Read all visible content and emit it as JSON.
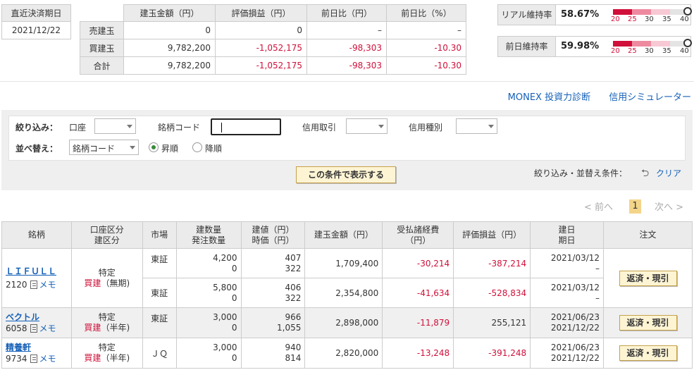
{
  "settlement": {
    "label": "直近決済期日",
    "date": "2021/12/22"
  },
  "summary": {
    "headers": [
      "建玉金額（円）",
      "評価損益（円）",
      "前日比（円）",
      "前日比（%）"
    ],
    "rows": [
      {
        "label": "売建玉",
        "amount": "0",
        "pl": "0",
        "diff_yen": "–",
        "diff_pct": "–"
      },
      {
        "label": "買建玉",
        "amount": "9,782,200",
        "pl": "-1,052,175",
        "diff_yen": "-98,303",
        "diff_pct": "-10.30"
      },
      {
        "label": "合計",
        "amount": "9,782,200",
        "pl": "-1,052,175",
        "diff_yen": "-98,303",
        "diff_pct": "-10.30"
      }
    ]
  },
  "ratios": [
    {
      "label": "リアル維持率",
      "value": "58.67%",
      "ticks": [
        "20",
        "25",
        "30",
        "35",
        "40"
      ]
    },
    {
      "label": "前日維持率",
      "value": "59.98%",
      "ticks": [
        "20",
        "25",
        "30",
        "35",
        "40"
      ]
    }
  ],
  "links": {
    "diagnosis": "MONEX 投資力診断",
    "simulator": "信用シミュレーター"
  },
  "filter": {
    "narrow_label": "絞り込み：",
    "account_label": "口座",
    "code_label": "銘柄コード",
    "credit_type_label": "信用取引",
    "credit_kind_label": "信用種別",
    "sort_label": "並べ替え：",
    "sort_value": "銘柄コード",
    "asc_label": "昇順",
    "desc_label": "降順",
    "show_button": "この条件で表示する",
    "condition_label": "絞り込み・並替え条件：",
    "clear_label": "クリア"
  },
  "pager": {
    "prev": "< 前へ",
    "current": "1",
    "next": "次へ >"
  },
  "table": {
    "headers": {
      "symbol": "銘柄",
      "account": [
        "口座区分",
        "建区分"
      ],
      "market": "市場",
      "qty": [
        "建数量",
        "発注数量"
      ],
      "price": [
        "建値（円）",
        "時価（円）"
      ],
      "amount": "建玉金額（円）",
      "fee": [
        "受払諸経費",
        "（円）"
      ],
      "pl": "評価損益（円）",
      "date": [
        "建日",
        "期日"
      ],
      "order": "注文"
    },
    "memo_label": "メモ",
    "action_label": "返済・現引",
    "groups": [
      {
        "name": "ＬＩＦＵＬＬ",
        "code": "2120",
        "account": "特定",
        "type": "買建",
        "term": "（無期)",
        "rows": [
          {
            "market": "東証",
            "qty": "4,200",
            "order_qty": "0",
            "price": "407",
            "market_price": "322",
            "amount": "1,709,400",
            "fee": "-30,214",
            "pl": "-387,214",
            "date": "2021/03/12",
            "due": "–"
          },
          {
            "market": "東証",
            "qty": "5,800",
            "order_qty": "0",
            "price": "406",
            "market_price": "322",
            "amount": "2,354,800",
            "fee": "-41,634",
            "pl": "-528,834",
            "date": "2021/03/12",
            "due": "–"
          }
        ]
      },
      {
        "name": "ベクトル",
        "code": "6058",
        "account": "特定",
        "type": "買建",
        "term": "（半年)",
        "rows": [
          {
            "market": "東証",
            "qty": "3,000",
            "order_qty": "0",
            "price": "966",
            "market_price": "1,055",
            "amount": "2,898,000",
            "fee": "-11,879",
            "pl": "255,121",
            "date": "2021/06/23",
            "due": "2021/12/22"
          }
        ]
      },
      {
        "name": "精養軒",
        "code": "9734",
        "account": "特定",
        "type": "買建",
        "term": "（半年)",
        "rows": [
          {
            "market": "ＪＱ",
            "qty": "3,000",
            "order_qty": "0",
            "price": "940",
            "market_price": "814",
            "amount": "2,820,000",
            "fee": "-13,248",
            "pl": "-391,248",
            "date": "2021/06/23",
            "due": "2021/12/22"
          }
        ]
      }
    ]
  },
  "colors": {
    "negative": "#d0103a",
    "link": "#1560b8",
    "button_fill": "#fdf4d4",
    "gauge_red": "#d0103a",
    "gauge_pink": "#f2b3c1"
  }
}
